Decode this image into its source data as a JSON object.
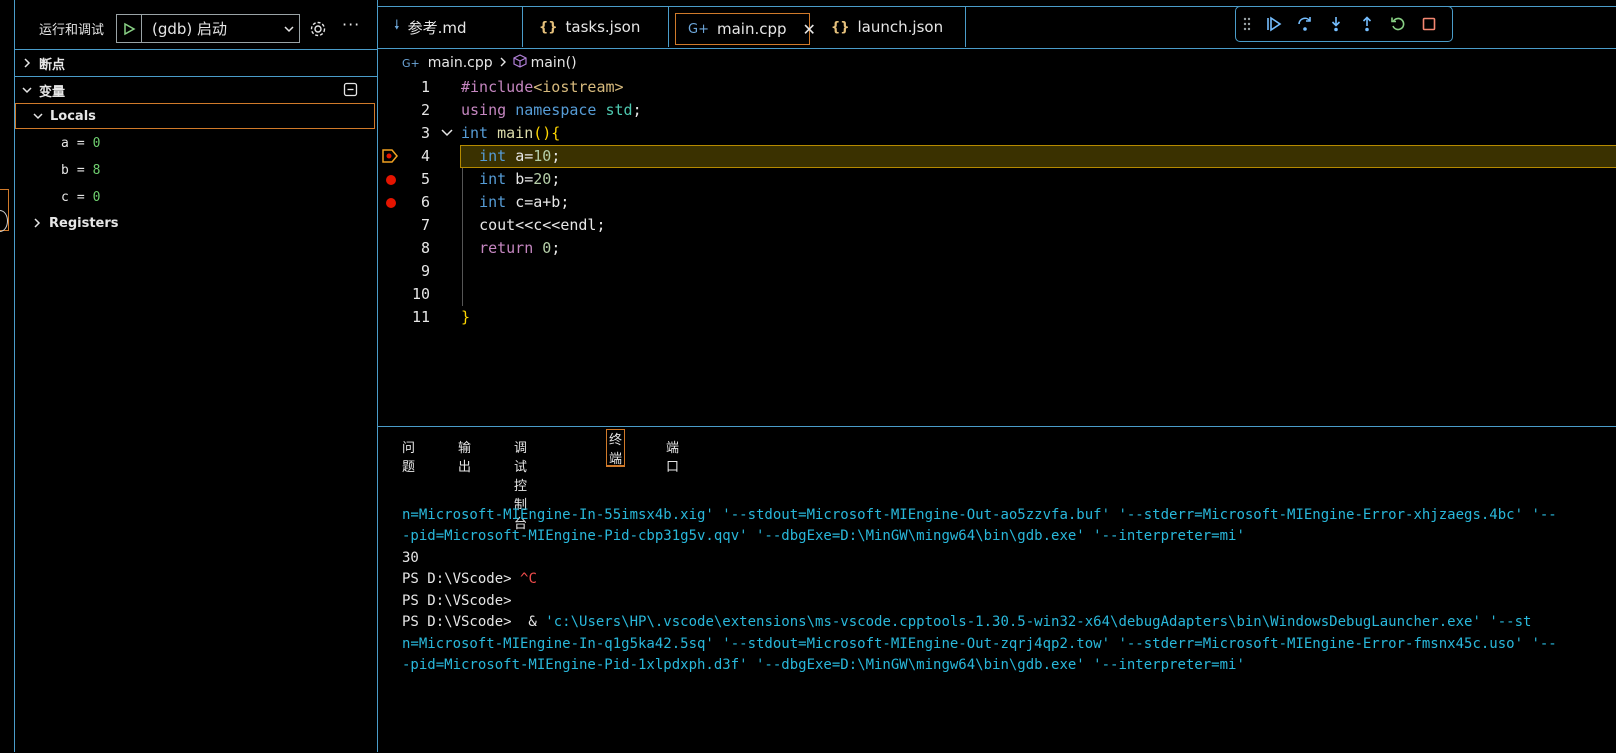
{
  "sidebar": {
    "title": "运行和调试",
    "launch_config": "(gdb) 启动",
    "more": "···",
    "breakpoints_label": "断点",
    "variables_label": "变量",
    "locals_label": "Locals",
    "locals": [
      {
        "name": "a",
        "value": "0"
      },
      {
        "name": "b",
        "value": "8"
      },
      {
        "name": "c",
        "value": "0"
      }
    ],
    "registers_label": "Registers"
  },
  "tabs": [
    {
      "label": "参考.md",
      "icon": "markdown-icon"
    },
    {
      "label": "tasks.json",
      "icon": "json-icon"
    },
    {
      "label": "main.cpp",
      "icon": "cpp-icon",
      "active": true
    },
    {
      "label": "launch.json",
      "icon": "json-icon"
    }
  ],
  "breadcrumb": {
    "file": "main.cpp",
    "symbol": "main()"
  },
  "editor": {
    "line_numbers": [
      "1",
      "2",
      "3",
      "4",
      "5",
      "6",
      "7",
      "8",
      "9",
      "10",
      "11"
    ],
    "current_line": 4,
    "breakpoints": [
      5,
      6
    ]
  },
  "panel": {
    "tabs": [
      "问题",
      "输出",
      "调试控制台",
      "终端",
      "端口"
    ],
    "active_tab": "终端",
    "terminal_lines": [
      "n=Microsoft-MIEngine-In-55imsx4b.xig' '--stdout=Microsoft-MIEngine-Out-ao5zzvfa.buf' '--stderr=Microsoft-MIEngine-Error-xhjzaegs.4bc' '--",
      "-pid=Microsoft-MIEngine-Pid-cbp31g5v.qqv' '--dbgExe=D:\\MinGW\\mingw64\\bin\\gdb.exe' '--interpreter=mi'",
      "30",
      "PS D:\\VScode> ",
      "PS D:\\VScode>",
      "PS D:\\VScode>  & ",
      "n=Microsoft-MIEngine-In-q1g5ka42.5sq' '--stdout=Microsoft-MIEngine-Out-zqrj4qp2.tow' '--stderr=Microsoft-MIEngine-Error-fmsnx45c.uso' '--",
      "-pid=Microsoft-MIEngine-Pid-1xlpdxph.d3f' '--dbgExe=D:\\MinGW\\mingw64\\bin\\gdb.exe' '--interpreter=mi'"
    ],
    "ctrl_c": "^C",
    "launcher_cmd": "'c:\\Users\\HP\\.vscode\\extensions\\ms-vscode.cpptools-1.30.5-win32-x64\\debugAdapters\\bin\\WindowsDebugLauncher.exe' '--st"
  },
  "colors": {
    "accent_border": "#4a9cc9",
    "focus_border": "#d07a2a",
    "breakpoint": "#e51400",
    "current_line_bg": "#3a3100"
  }
}
